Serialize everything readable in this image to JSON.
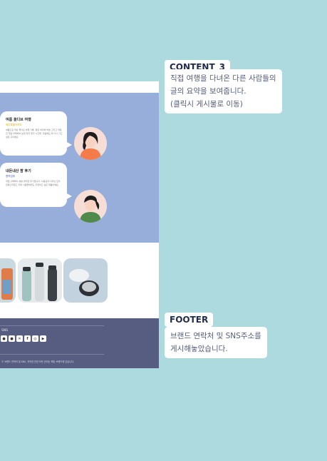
{
  "content_review": {
    "items": [
      {
        "title": "여름 올디브 여행",
        "subtitle": "제주특별자치도",
        "body": "여름으로 떠난 올디브 여행 기록. 맑은 바다와 하늘 그리고 따뜻한 햇살 아래에서 보낸 잊지 못할 시간들. 다음에도 꼭 다시 가고 싶은 곳이에요."
      },
      {
        "title": "내돈내산 팜 후기",
        "subtitle": "협력업체",
        "body": "직접 구매해서 써본 솔직한 후기입니다. 사용감과 디자인 모두 만족스러웠고 주변 사람들에게도 추천하고 싶은 제품이에요."
      }
    ]
  },
  "footer_block": {
    "label": "SNS",
    "icons": [
      "sns-chat-icon",
      "sns-talk-icon",
      "sns-x-icon",
      "sns-facebook-icon",
      "sns-instagram-icon",
      "sns-youtube-icon"
    ],
    "copyright": "© 브랜드 연락처 및 SNS. 저작권 관련 모든 권리는 해당 브랜드에 있습니다."
  },
  "annotations": {
    "content3": {
      "tag": "CONTENT_3",
      "desc": [
        "직접 여행을 다녀온 다른 사람들의",
        "글의 요약을 보여줍니다.",
        "(클릭시 게시물로 이동)"
      ]
    },
    "footer": {
      "tag": "FOOTER",
      "desc": [
        "브랜드 연락처 및 SNS주소를",
        "게시해놓았습니다."
      ]
    }
  }
}
